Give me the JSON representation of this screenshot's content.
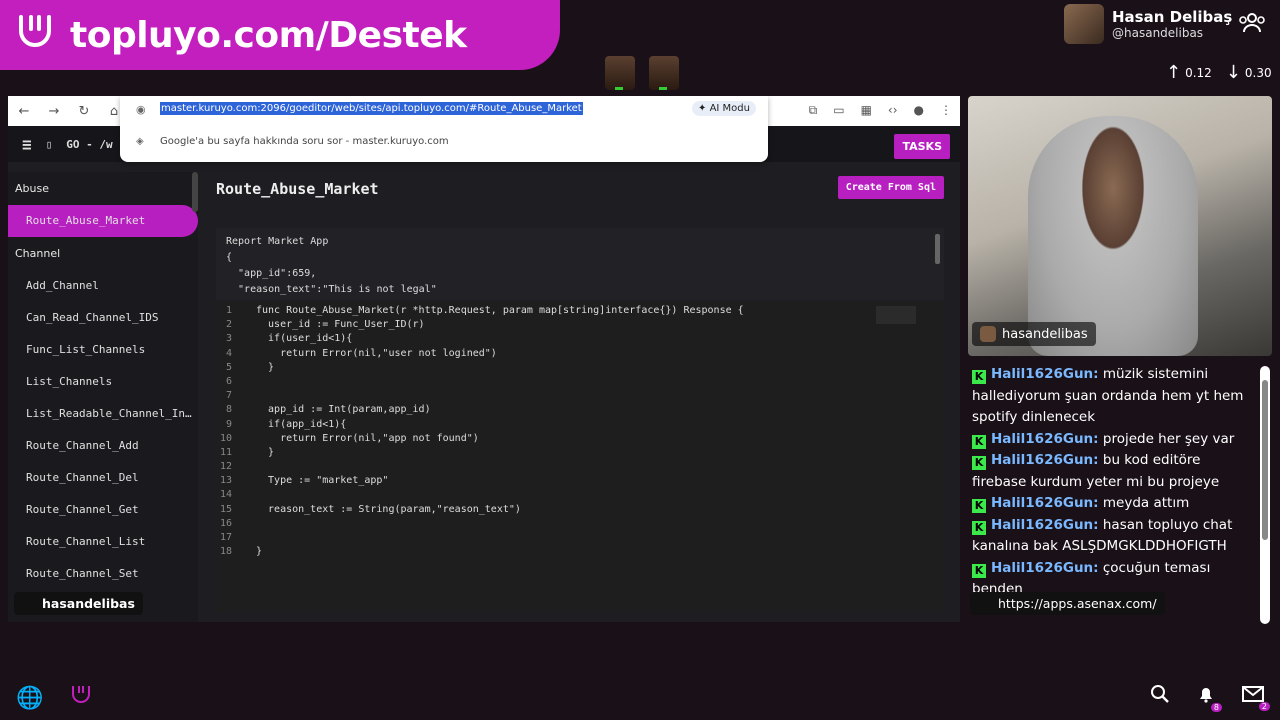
{
  "banner": {
    "title": "topluyo.com/Destek"
  },
  "profile": {
    "name": "Hasan Delibaş",
    "handle": "@hasandelibas"
  },
  "stats": {
    "up": "0.12",
    "down": "0.30"
  },
  "browser": {
    "url": "master.kuruyo.com:2096/goeditor/web/sites/api.topluyo.com/#Route_Abuse_Market",
    "ai_mode": "AI Modu",
    "suggestion": "Google'a bu sayfa hakkında soru sor - master.kuruyo.com"
  },
  "app": {
    "header_title": "GO - /w",
    "tasks_label": "TASKS",
    "page_title": "Route_Abuse_Market",
    "create_label": "Create From Sql",
    "sidebar": [
      {
        "type": "group",
        "label": "Abuse"
      },
      {
        "type": "item",
        "label": "Route_Abuse_Market",
        "active": true
      },
      {
        "type": "group",
        "label": "Channel"
      },
      {
        "type": "item",
        "label": "Add_Channel"
      },
      {
        "type": "item",
        "label": "Can_Read_Channel_IDS"
      },
      {
        "type": "item",
        "label": "Func_List_Channels"
      },
      {
        "type": "item",
        "label": "List_Channels"
      },
      {
        "type": "item",
        "label": "List_Readable_Channel_In…"
      },
      {
        "type": "item",
        "label": "Route_Channel_Add"
      },
      {
        "type": "item",
        "label": "Route_Channel_Del"
      },
      {
        "type": "item",
        "label": "Route_Channel_Get"
      },
      {
        "type": "item",
        "label": "Route_Channel_List"
      },
      {
        "type": "item",
        "label": "Route_Channel_Set"
      }
    ],
    "description": [
      "Report Market App",
      "{",
      "  \"app_id\":659,",
      "  \"reason_text\":\"This is not legal\""
    ],
    "code": [
      "func Route_Abuse_Market(r *http.Request, param map[string]interface{}) Response {",
      "  user_id := Func_User_ID(r)",
      "  if(user_id<1){",
      "    return Error(nil,\"user not logined\")",
      "  }",
      "",
      "",
      "  app_id := Int(param,app_id)",
      "  if(app_id<1){",
      "    return Error(nil,\"app not found\")",
      "  }",
      "",
      "  Type := \"market_app\"",
      "",
      "  reason_text := String(param,\"reason_text\")",
      "",
      "",
      "}"
    ]
  },
  "webcam": {
    "label": "hasandelibas"
  },
  "chat": [
    {
      "user": "Halil1626Gun:",
      "text": "müzik sistemini hallediyorum şuan ordanda hem yt hem spotify dinlenecek"
    },
    {
      "user": "Halil1626Gun:",
      "text": "projede her şey var"
    },
    {
      "user": "Halil1626Gun:",
      "text": "bu kod editöre firebase kurdum yeter mi bu projeye"
    },
    {
      "user": "Halil1626Gun:",
      "text": "meyda attım"
    },
    {
      "user": "Halil1626Gun:",
      "text": "hasan topluyo chat kanalına bak ASLŞDMGKLDDHOFIGTH"
    },
    {
      "user": "Halil1626Gun:",
      "text": "çocuğun teması benden"
    }
  ],
  "link_pill": "https://apps.asenax.com/",
  "user_pill": "hasandelibas",
  "bottom": {
    "notif_count": "8",
    "mail_count": "2"
  },
  "colors": {
    "brand": "#c21fbe",
    "accent": "#b81fc0",
    "chat_user": "#7ab8ff",
    "kick_green": "#3ce94b"
  }
}
